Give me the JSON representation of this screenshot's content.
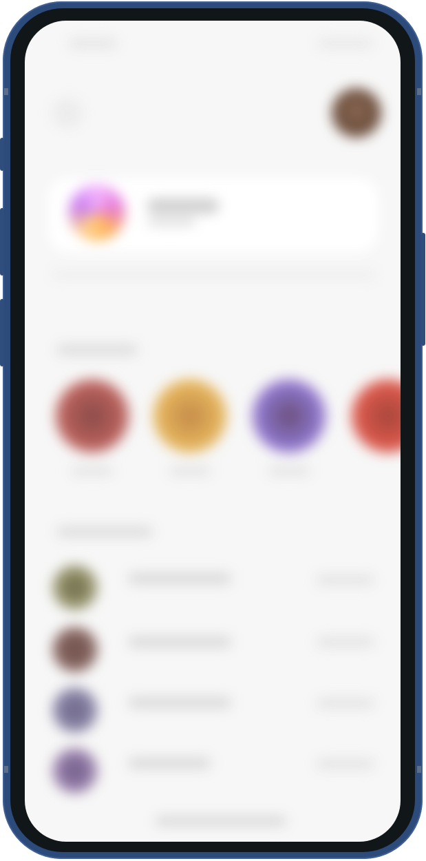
{
  "device": {
    "frame_color": "#2c4a7a",
    "bezel_color": "#111619",
    "screen_background": "#f7f7f7"
  },
  "screen": {
    "state": "blurred",
    "header": {
      "back_icon": "back-icon",
      "avatar_icon": "profile-avatar"
    },
    "profile_card": {
      "story_ring_colors": [
        "#f5b6ff",
        "#e57ad8",
        "#ffb35c",
        "#c87df0"
      ]
    },
    "stories": [
      {
        "color": "#b75f5a"
      },
      {
        "color": "#e2b15a"
      },
      {
        "color": "#8a74c8"
      },
      {
        "color": "#d8574a"
      }
    ],
    "list": [
      {
        "avatar_color": "#7c7a5e"
      },
      {
        "avatar_color": "#8b6b66"
      },
      {
        "avatar_color": "#8c88a8"
      },
      {
        "avatar_color": "#9c84b0"
      }
    ]
  }
}
